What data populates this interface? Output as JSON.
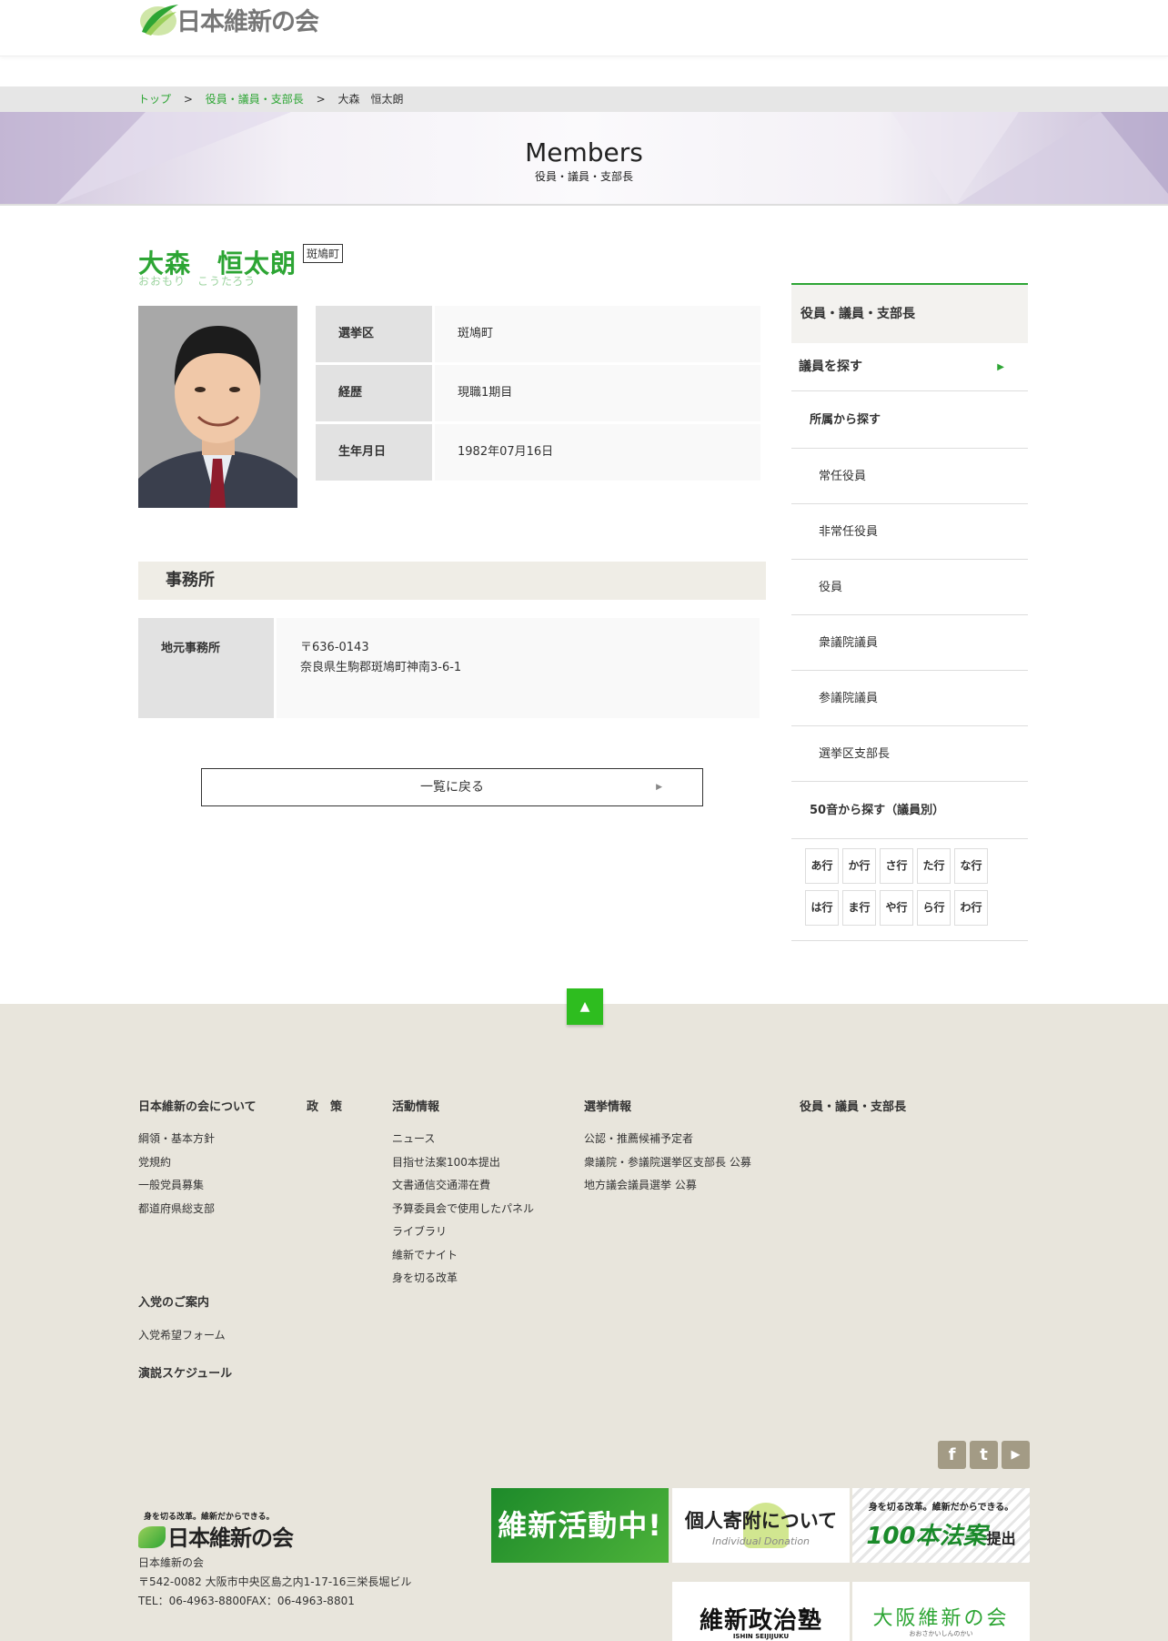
{
  "header": {
    "logo_text": "日本維新の会"
  },
  "breadcrumb": {
    "items": [
      "トップ",
      "役員・議員・支部長",
      "大森　恒太朗"
    ],
    "sep": ">"
  },
  "hero": {
    "title": "Members",
    "subtitle": "役員・議員・支部長"
  },
  "profile": {
    "name": "大森　恒太朗",
    "region_tag": "斑鳩町",
    "kana": "おおもり　こうたろう",
    "rows": [
      {
        "label": "選挙区",
        "value": "斑鳩町"
      },
      {
        "label": "経歴",
        "value": "現職1期目"
      },
      {
        "label": "生年月日",
        "value": "1982年07月16日"
      }
    ]
  },
  "office": {
    "heading": "事務所",
    "label": "地元事務所",
    "postal": "〒636-0143",
    "address": "奈良県生駒郡斑鳩町神南3-6-1"
  },
  "back_button": {
    "label": "一覧に戻る",
    "arrow": "▶"
  },
  "sidebar": {
    "heading": "役員・議員・支部長",
    "search": "議員を探す",
    "search_arrow": "▶",
    "by_affiliation": "所属から探す",
    "affiliations": [
      "常任役員",
      "非常任役員",
      "役員",
      "衆議院議員",
      "参議院議員",
      "選挙区支部長"
    ],
    "by_kana": "50音から探す（議員別）",
    "kana_rows": [
      [
        "あ行",
        "か行",
        "さ行",
        "た行",
        "な行"
      ],
      [
        "は行",
        "ま行",
        "や行",
        "ら行",
        "わ行"
      ]
    ]
  },
  "totop": "▲",
  "footer": {
    "col1": {
      "heading": "日本維新の会について",
      "links": [
        "綱領・基本方針",
        "党規約",
        "一般党員募集",
        "都道府県総支部"
      ]
    },
    "col2": {
      "heading": "政　策"
    },
    "col3": {
      "heading": "活動情報",
      "links": [
        "ニュース",
        "目指せ法案100本提出",
        "文書通信交通滞在費",
        "予算委員会で使用したパネル",
        "ライブラリ",
        "維新でナイト",
        "身を切る改革"
      ]
    },
    "col4": {
      "heading": "選挙情報",
      "links": [
        "公認・推薦候補予定者",
        "衆議院・参議院選挙区支部長 公募",
        "地方議会議員選挙 公募"
      ]
    },
    "col5": {
      "heading": "役員・議員・支部長"
    },
    "join": {
      "heading": "入党のご案内",
      "link": "入党希望フォーム"
    },
    "schedule": "演説スケジュール",
    "social": [
      {
        "icon": "facebook-icon",
        "glyph": "f"
      },
      {
        "icon": "twitter-icon",
        "glyph": "t"
      },
      {
        "icon": "youtube-icon",
        "glyph": "▶"
      }
    ],
    "banners": {
      "activity": "維新活動中!",
      "donation": "個人寄附について",
      "donation_en": "Individual Donation",
      "bills_small": "身を切る改革。維新だからできる。",
      "bills_big": "100本法案",
      "bills_end": "提出",
      "juku": "維新政治塾",
      "juku_en": "ISHIN SEIJIJUKU",
      "osaka": "大阪維新の会",
      "osaka_kana": "おおさかいしんのかい"
    },
    "logo_copy": "身を切る改革。維新だからできる。",
    "logo_text": "日本維新の会",
    "org_name": "日本維新の会",
    "org_address": "〒542-0082 大阪市中央区島之内1-17-16三栄長堀ビル",
    "org_tel": "TEL：06-4963-8800FAX：06-4963-8801"
  },
  "colors": {
    "accent": "#2da534",
    "footer_bg": "#e8e5dc",
    "totop": "#2ebd1f"
  }
}
